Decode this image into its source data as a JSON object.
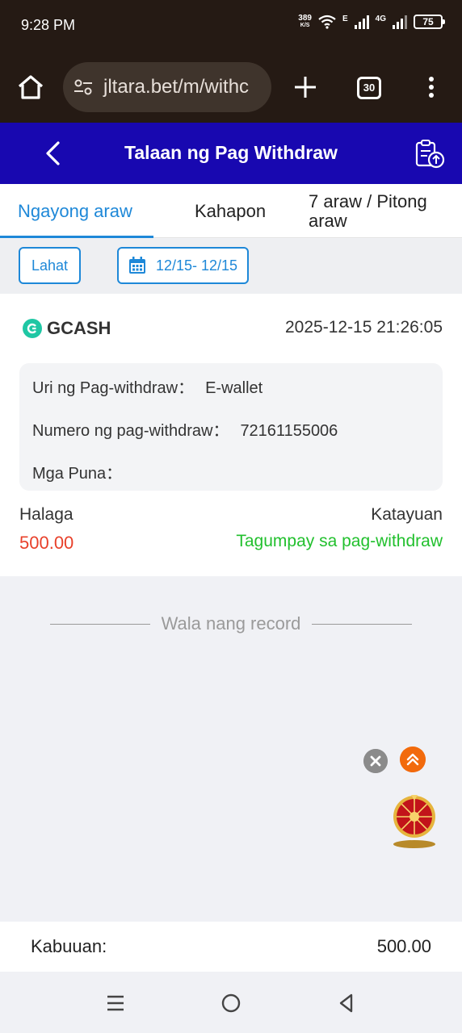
{
  "status_bar": {
    "time": "9:28 PM",
    "net_speed": "389",
    "net_speed_unit": "K/S",
    "network_e": "E",
    "network_4g": "4G",
    "battery": "75",
    "icons": [
      "wifi-icon",
      "signal-icon",
      "battery-icon"
    ]
  },
  "browser": {
    "url": "jltara.bet/m/withc",
    "tab_count": "30",
    "icons": [
      "home-icon",
      "tune-icon",
      "plus-icon",
      "tabs-icon",
      "more-icon"
    ]
  },
  "header": {
    "title": "Talaan ng Pag Withdraw",
    "icons": [
      "back-icon",
      "record-upload-icon"
    ],
    "color": "#1808b0"
  },
  "tabs": [
    {
      "label": "Ngayong araw",
      "active": true
    },
    {
      "label": "Kahapon",
      "active": false
    },
    {
      "label": "7 araw / Pitong araw",
      "active": false
    }
  ],
  "filters": {
    "all_label": "Lahat",
    "date_range": "12/15- 12/15"
  },
  "record": {
    "method": "GCASH",
    "datetime": "2025-12-15 21:26:05",
    "type_label": "Uri ng Pag-withdraw：",
    "type_value": "E-wallet",
    "number_label": "Numero ng pag-withdraw：",
    "number_value": "72161155006",
    "remarks_label": "Mga Puna：",
    "amount_label": "Halaga",
    "amount_value": "500.00",
    "status_label": "Katayuan",
    "status_value": "Tagumpay sa pag-withdraw",
    "amount_color": "#e8402a",
    "status_color": "#22c02e"
  },
  "list_end_text": "Wala nang record",
  "floating": [
    "close-icon",
    "scroll-top-icon",
    "lucky-wheel-icon"
  ],
  "total": {
    "label": "Kabuuan:",
    "value": "500.00"
  },
  "nav": [
    "menu-icon",
    "home-circle-icon",
    "back-triangle-icon"
  ]
}
